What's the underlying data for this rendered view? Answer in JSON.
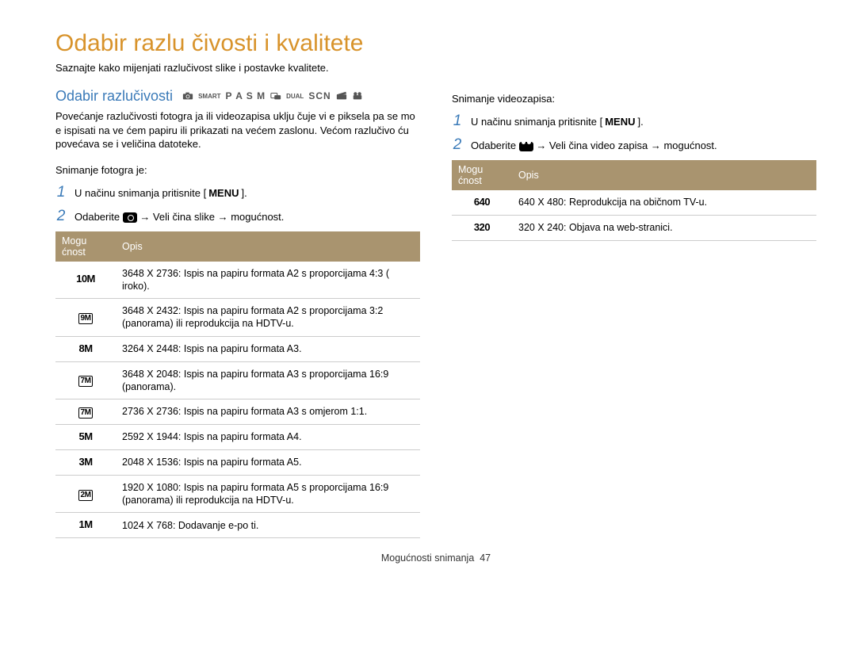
{
  "title": "Odabir razlu čivosti i kvalitete",
  "intro": "Saznajte kako mijenjati razlučivost slike i postavke kvalitete.",
  "left": {
    "subheading": "Odabir razlučivosti",
    "modes": {
      "smart": "SMART",
      "pasm": "P A S M",
      "dual": "DUAL",
      "scn": "SCN"
    },
    "paragraph": "Povećanje razlučivosti fotogra ja ili videozapisa uklju čuje vi e piksela pa se mo e ispisati na ve ćem papiru ili prikazati na većem zaslonu. Većom razlučivo ću povećava se i veličina datoteke.",
    "photo_label": "Snimanje fotogra   je:",
    "step1_pre": "U načinu snimanja pritisnite [",
    "step1_menu": "MENU",
    "step1_post": "].",
    "step2_pre": "Odaberite ",
    "step2_mid": " → Veli čina slike → mogućnost.",
    "table": {
      "head1": "Mogu ćnost",
      "head2": "Opis",
      "rows": [
        {
          "icon": "10M",
          "box": false,
          "text": "3648 X 2736: Ispis na papiru formata A2 s proporcijama 4:3 ( iroko)."
        },
        {
          "icon": "9M",
          "box": true,
          "text": "3648 X 2432: Ispis na papiru formata A2 s proporcijama 3:2 (panorama) ili reprodukcija na HDTV-u."
        },
        {
          "icon": "8M",
          "box": false,
          "text": "3264 X 2448: Ispis na papiru formata A3."
        },
        {
          "icon": "7M",
          "box": true,
          "text": "3648 X 2048: Ispis na papiru formata A3 s proporcijama 16:9 (panorama)."
        },
        {
          "icon": "7M",
          "box": true,
          "text": "2736 X 2736: Ispis na papiru formata A3 s omjerom 1:1."
        },
        {
          "icon": "5M",
          "box": false,
          "text": "2592 X 1944: Ispis na papiru formata A4."
        },
        {
          "icon": "3M",
          "box": false,
          "text": "2048 X 1536: Ispis na papiru formata A5."
        },
        {
          "icon": "2M",
          "box": true,
          "text": "1920 X 1080: Ispis na papiru formata A5 s proporcijama 16:9 (panorama) ili reprodukcija na HDTV-u."
        },
        {
          "icon": "1M",
          "box": false,
          "text": "1024 X 768: Dodavanje e-po ti."
        }
      ]
    }
  },
  "right": {
    "video_label": "Snimanje videozapisa:",
    "step1_pre": "U načinu snimanja pritisnite [",
    "step1_menu": "MENU",
    "step1_post": "].",
    "step2_pre": "Odaberite ",
    "step2_mid": " → Veli čina video zapisa  → mogućnost.",
    "table": {
      "head1": "Mogu ćnost",
      "head2": "Opis",
      "rows": [
        {
          "icon": "640",
          "text": "640 X 480: Reprodukcija na običnom TV-u."
        },
        {
          "icon": "320",
          "text": "320 X 240: Objava na web-stranici."
        }
      ]
    }
  },
  "footer": {
    "section": "Mogućnosti snimanja",
    "page": "47"
  }
}
